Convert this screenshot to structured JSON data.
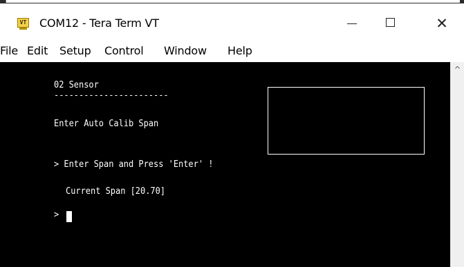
{
  "window": {
    "title": "COM12 - Tera Term VT",
    "icon": "teraterm-vt-icon",
    "icon_label": "VT",
    "buttons": {
      "minimize": "minimize-icon",
      "maximize": "maximize-icon",
      "close": "close-icon",
      "close_glyph": "✕"
    }
  },
  "menu": {
    "file": "File",
    "edit": "Edit",
    "setup": "Setup",
    "control": "Control",
    "window": "Window",
    "help": "Help"
  },
  "terminal": {
    "lines": {
      "heading": "02 Sensor",
      "divider": "-----------------------",
      "mode": "Enter Auto Calib Span",
      "prompt": "> Enter Span and Press 'Enter' !",
      "current": "Current Span [20.70]",
      "input_prompt": ">"
    },
    "colors": {
      "background": "#000000",
      "foreground": "#ffffff"
    }
  },
  "scrollbar": {
    "up_arrow": "^"
  }
}
